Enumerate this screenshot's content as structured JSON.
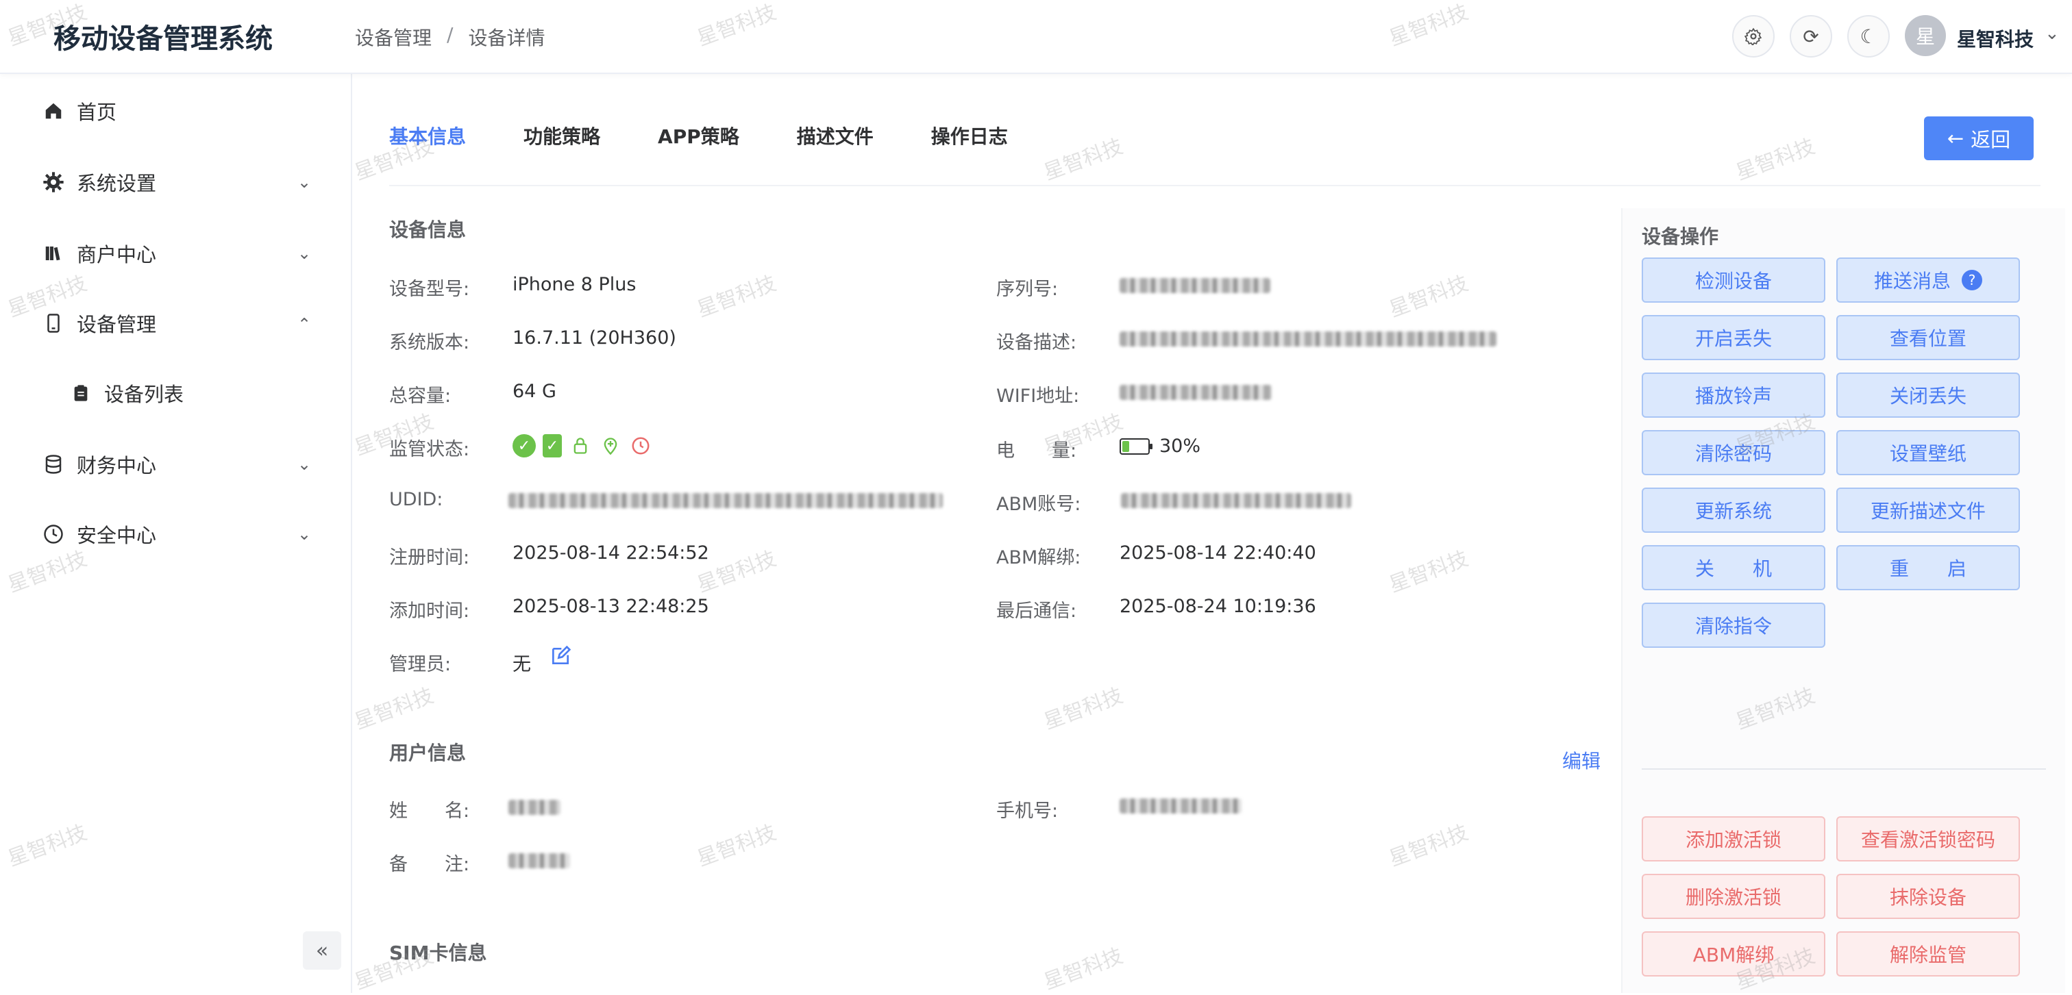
{
  "app": {
    "title": "移动设备管理系统"
  },
  "breadcrumb": [
    "设备管理",
    "设备详情"
  ],
  "header": {
    "settings_icon": "gear-icon",
    "refresh_icon": "refresh-icon",
    "theme_icon": "moon-icon",
    "avatar_text": "星",
    "user_name": "星智科技"
  },
  "sidebar": {
    "items": [
      {
        "label": "首页",
        "icon": "home-icon"
      },
      {
        "label": "系统设置",
        "icon": "gear-icon"
      },
      {
        "label": "商户中心",
        "icon": "book-icon"
      },
      {
        "label": "设备管理",
        "icon": "phone-icon"
      },
      {
        "label": "设备列表",
        "icon": "clipboard-icon"
      },
      {
        "label": "财务中心",
        "icon": "database-icon"
      },
      {
        "label": "安全中心",
        "icon": "clock-icon"
      }
    ]
  },
  "tabs": [
    "基本信息",
    "功能策略",
    "APP策略",
    "描述文件",
    "操作日志"
  ],
  "back_button": "返回",
  "device_info": {
    "title": "设备信息",
    "model_label": "设备型号:",
    "model": "iPhone 8 Plus",
    "os_label": "系统版本:",
    "os": "16.7.11 (20H360)",
    "capacity_label": "总容量:",
    "capacity": "64 G",
    "supervision_label": "监管状态:",
    "udid_label": "UDID:",
    "register_label": "注册时间:",
    "register": "2025-08-14 22:54:52",
    "added_label": "添加时间:",
    "added": "2025-08-13 22:48:25",
    "admin_label": "管理员:",
    "admin": "无",
    "serial_label": "序列号:",
    "desc_label": "设备描述:",
    "wifi_label": "WIFI地址:",
    "battery_label": "电　　量:",
    "battery": "30%",
    "abm_account_label": "ABM账号:",
    "abm_unbind_label": "ABM解绑:",
    "abm_unbind": "2025-08-14 22:40:40",
    "last_comm_label": "最后通信:",
    "last_comm": "2025-08-24 10:19:36"
  },
  "user_info": {
    "title": "用户信息",
    "edit": "编辑",
    "name_label": "姓　　名:",
    "remark_label": "备　　注:",
    "phone_label": "手机号:"
  },
  "sim_info": {
    "title": "SIM卡信息"
  },
  "operations": {
    "title": "设备操作",
    "primary": [
      "检测设备",
      "推送消息",
      "开启丢失",
      "查看位置",
      "播放铃声",
      "关闭丢失",
      "清除密码",
      "设置壁纸",
      "更新系统",
      "更新描述文件",
      "关　　机",
      "重　　启",
      "清除指令"
    ],
    "danger": [
      "添加激活锁",
      "查看激活锁密码",
      "删除激活锁",
      "抹除设备",
      "ABM解绑",
      "解除监管"
    ]
  },
  "watermark": "星智科技"
}
